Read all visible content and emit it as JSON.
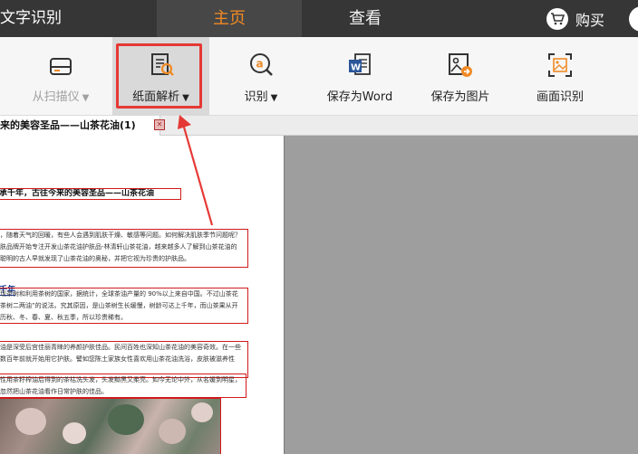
{
  "window": {
    "app_title": "文字识别"
  },
  "nav": {
    "tabs": [
      {
        "label": "主页",
        "active": true
      },
      {
        "label": "查看",
        "active": false
      }
    ],
    "buy_label": "购买"
  },
  "toolbar": {
    "items": [
      {
        "label": "从扫描仪",
        "icon": "scanner-icon",
        "has_dropdown": true,
        "enabled": false
      },
      {
        "label": "纸面解析",
        "icon": "document-analysis-icon",
        "has_dropdown": true,
        "enabled": true,
        "highlighted": true
      },
      {
        "label": "识别",
        "icon": "recognize-icon",
        "has_dropdown": true,
        "enabled": true
      },
      {
        "label": "保存为Word",
        "icon": "word-icon",
        "has_dropdown": false,
        "enabled": true
      },
      {
        "label": "保存为图片",
        "icon": "save-image-icon",
        "has_dropdown": false,
        "enabled": true
      },
      {
        "label": "画面识别",
        "icon": "screen-capture-icon",
        "has_dropdown": false,
        "enabled": true
      }
    ],
    "dropdown_glyph": "▼"
  },
  "document_tab": {
    "title": "来的美容圣品——山茶花油(1)",
    "close_glyph": "✕"
  },
  "document": {
    "heading": "承千年，古往今来的美容圣品——山茶花油",
    "paragraph1": [
      "，随着天气的回暖，有些人会遇到肌肤干燥、敏感等问题。如何解决肌肤季节问题呢？",
      "肤品牌开始专注开发山茶花油护肤品-林清轩山茶花油，越来越多人了解到山茶花油的",
      "聪明的古人早就发现了山茶花油的奥秘，并把它视为珍贵的护肤品。"
    ],
    "subheading": "千年",
    "paragraph2": [
      "现茶树和利用茶树的国家，据统计，全球茶油产量的 90%以上来自中国。不过山茶花",
      "茶树二两油”的说法。究其原因，是山茶树生长缓慢，树龄可达上千年，而山茶果从开",
      "历秋、冬、春、夏、秋五季，所以珍贵稀有。"
    ],
    "paragraph3": [
      "油是深受后宫佳丽青睐的养颜护肤佳品。民间百姓也深知山茶花油的美容奇效。在一些",
      "数百年前就开始用它护肤。譬如您陈土家族女性喜欢用山茶花油洗浴，皮肤被滋养性"
    ],
    "paragraph4": [
      "性用茶籽榨油后得到的茶枯洗头发，头发黝黑又柔亮。如今无论中外，从名媛到明星，",
      "忽然把山茶花油看作日常护肤的佳品。"
    ]
  },
  "colors": {
    "topbar_bg": "#363636",
    "active_tab_text": "#f08a24",
    "highlight_red": "#e53935",
    "preview_bg": "#9e9e9e"
  }
}
